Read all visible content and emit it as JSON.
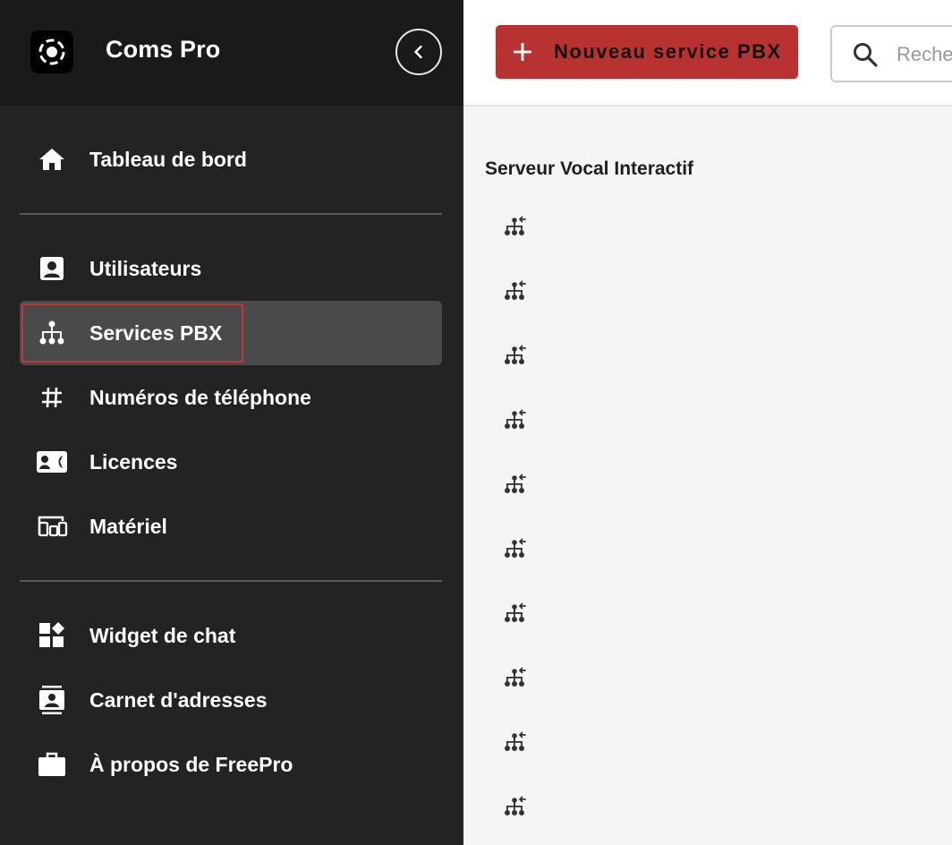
{
  "app": {
    "title": "Coms Pro"
  },
  "sidebar": {
    "items": [
      {
        "label": "Tableau de bord",
        "icon": "home-icon"
      },
      {
        "label": "Utilisateurs",
        "icon": "user-icon"
      },
      {
        "label": "Services PBX",
        "icon": "sitemap-icon",
        "active": true
      },
      {
        "label": "Numéros de téléphone",
        "icon": "hash-icon"
      },
      {
        "label": "Licences",
        "icon": "license-icon"
      },
      {
        "label": "Matériel",
        "icon": "devices-icon"
      },
      {
        "label": "Widget de chat",
        "icon": "widgets-icon"
      },
      {
        "label": "Carnet d'adresses",
        "icon": "contacts-icon"
      },
      {
        "label": "À propos de FreePro",
        "icon": "briefcase-icon"
      }
    ]
  },
  "toolbar": {
    "new_button_label": "Nouveau service PBX",
    "search_placeholder": "Recherche"
  },
  "main": {
    "section_title": "Serveur Vocal Interactif",
    "rows": [
      {
        "icon": "ivr-icon",
        "label": ""
      },
      {
        "icon": "ivr-icon",
        "label": ""
      },
      {
        "icon": "ivr-icon",
        "label": ""
      },
      {
        "icon": "ivr-icon",
        "label": ""
      },
      {
        "icon": "ivr-icon",
        "label": ""
      },
      {
        "icon": "ivr-icon",
        "label": ""
      },
      {
        "icon": "ivr-icon",
        "label": ""
      },
      {
        "icon": "ivr-icon",
        "label": ""
      },
      {
        "icon": "ivr-icon",
        "label": ""
      },
      {
        "icon": "ivr-icon",
        "label": ""
      }
    ]
  },
  "colors": {
    "sidebar_bg": "#232323",
    "header_bg": "#1a1a1a",
    "active_bg": "#4a4a4a",
    "accent": "#b83232",
    "content_bg": "#f5f5f5"
  }
}
